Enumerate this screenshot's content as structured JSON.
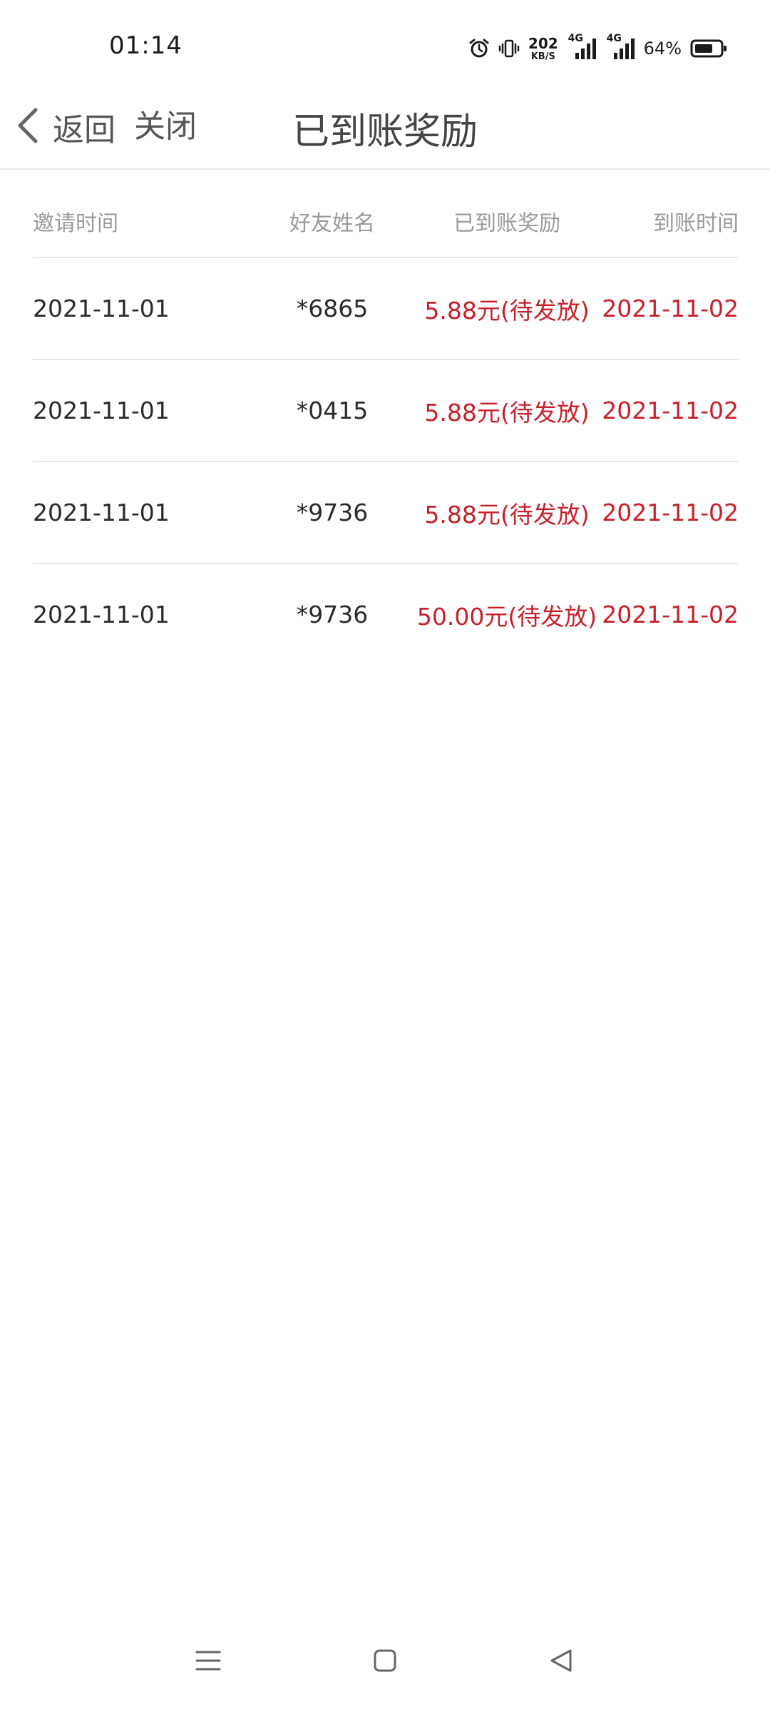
{
  "status_bar": {
    "time": "01:14",
    "speed_value": "202",
    "speed_unit": "KB/S",
    "sim1_label": "4G",
    "sim2_label": "4G",
    "battery_percent": "64%",
    "icons": [
      "alarm-icon",
      "vibrate-icon",
      "signal-icon",
      "signal-icon",
      "battery-icon"
    ]
  },
  "header": {
    "back_label": "返回",
    "close_label": "关闭",
    "title": "已到账奖励"
  },
  "table": {
    "columns": [
      "邀请时间",
      "好友姓名",
      "已到账奖励",
      "到账时间"
    ],
    "rows": [
      [
        "2021-11-01",
        "*6865",
        "5.88元(待发放)",
        "2021-11-02"
      ],
      [
        "2021-11-01",
        "*0415",
        "5.88元(待发放)",
        "2021-11-02"
      ],
      [
        "2021-11-01",
        "*9736",
        "5.88元(待发放)",
        "2021-11-02"
      ],
      [
        "2021-11-01",
        "*9736",
        "50.00元(待发放)",
        "2021-11-02"
      ]
    ]
  },
  "colors": {
    "accent_red": "#c8202a",
    "text_dark": "#2a2a2a",
    "header_gray": "#9a9a9a"
  },
  "nav_bar": {
    "icons": [
      "menu-icon",
      "home-icon",
      "back-triangle-icon"
    ]
  }
}
